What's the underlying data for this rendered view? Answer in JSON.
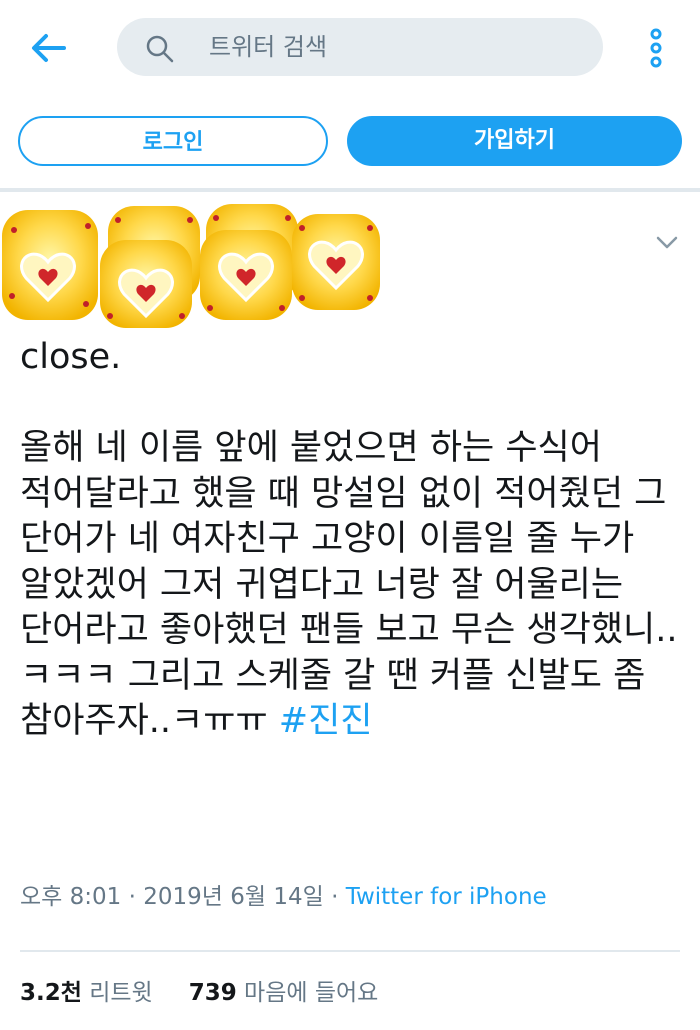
{
  "header": {
    "search_placeholder": "트위터 검색",
    "back_icon": "arrow-left-icon",
    "search_icon": "search-icon",
    "more_icon": "more-vertical-icon"
  },
  "auth": {
    "login_label": "로그인",
    "signup_label": "가입하기"
  },
  "tweet": {
    "avatar_icon": "golden-hearts-image",
    "menu_icon": "chevron-down-icon",
    "line_close": "close.",
    "body_text": "올해 네 이름 앞에 붙었으면 하는 수식어 적어달라고 했을 때 망설임 없이 적어줬던 그 단어가 네 여자친구 고양이 이름일 줄 누가 알았겠어 그저 귀엽다고 너랑 잘 어울리는 단어라고 좋아했던 팬들 보고 무슨 생각했니..ㅋㅋㅋ 그리고 스케줄 갈 땐 커플 신발도 좀 참아주자..ㅋㅠㅠ ",
    "hashtag": "#진진",
    "time": "오후 8:01",
    "date": "2019년 6월 14일",
    "source": "Twitter for iPhone",
    "retweet_count": "3.2천",
    "retweet_label": "리트윗",
    "like_count": "739",
    "like_label": "마음에 들어요"
  },
  "colors": {
    "brand": "#1da1f2",
    "secondary_text": "#657786",
    "search_bg": "#e6ecf0"
  }
}
